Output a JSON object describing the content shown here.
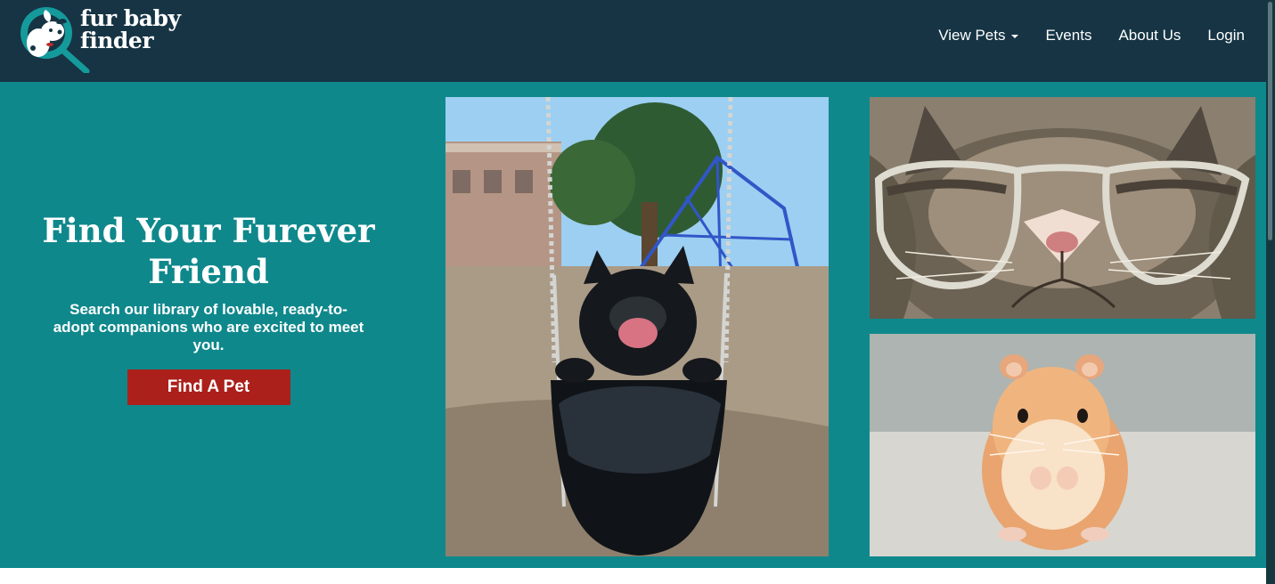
{
  "brand": {
    "line_one": "fur baby",
    "line_two": "finder",
    "mark": "dog-magnifier-icon"
  },
  "navigation": {
    "items": [
      {
        "label": "View Pets",
        "dropdown": true
      },
      {
        "label": "Events",
        "dropdown": false
      },
      {
        "label": "About Us",
        "dropdown": false
      },
      {
        "label": "Login",
        "dropdown": false
      }
    ]
  },
  "hero": {
    "headline_line_one": "Find Your Furever",
    "headline_line_two": "Friend",
    "description": "Search our library of lovable, ready-to-adopt companions who are excited to meet you.",
    "button_label": "Find A Pet"
  },
  "images": {
    "dog": "dog-on-swing-photo",
    "cat": "cat-with-glasses-photo",
    "hamster": "hamster-photo"
  },
  "colors": {
    "header": "#163444",
    "hero": "#0f888c",
    "button": "#ab201b",
    "text": "#ffffff"
  }
}
